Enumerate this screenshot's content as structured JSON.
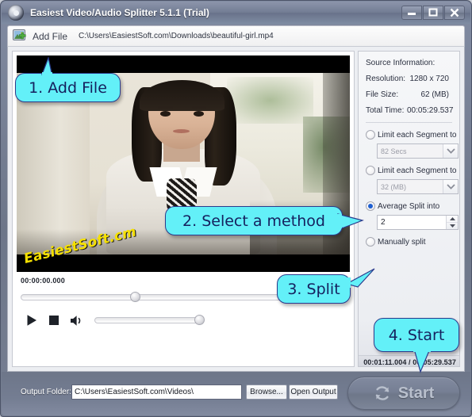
{
  "window": {
    "title": "Easiest Video/Audio Splitter 5.1.1 (Trial)",
    "logo_icon": "film-reel-icon",
    "buttons": {
      "minimize": "minimize-icon",
      "maximize": "maximize-icon",
      "close": "close-icon"
    }
  },
  "toolbar": {
    "add_file_icon": "add-image-plus-icon",
    "add_file_label": "Add File",
    "file_path": "C:\\Users\\EasiestSoft.com\\Downloads\\beautiful-girl.mp4"
  },
  "player": {
    "watermark": "EasiestSoft.cm",
    "current_time": "00:00:00.000",
    "duration_readout": "00:01:11.004 / 00:05:29.537",
    "seek_position_percent": 35,
    "volume_percent": 100,
    "controls": {
      "play": "play-icon",
      "stop": "stop-icon",
      "volume": "speaker-icon"
    }
  },
  "settings": {
    "source_title": "Source Information:",
    "info": [
      {
        "label": "Resolution:",
        "value": "1280 x 720"
      },
      {
        "label": "File Size:",
        "value": "62 (MB)"
      },
      {
        "label": "Total Time:",
        "value": "00:05:29.537"
      }
    ],
    "options": [
      {
        "label": "Limit each Segment to",
        "selected": false,
        "control": "combo",
        "value": "82 Secs"
      },
      {
        "label": "Limit each Segment to",
        "selected": false,
        "control": "combo",
        "value": "32 (MB)"
      },
      {
        "label": "Average Split into",
        "selected": true,
        "control": "spinner",
        "value": "2"
      },
      {
        "label": "Manually split",
        "selected": false,
        "control": "none",
        "value": ""
      }
    ],
    "split_button": "Split"
  },
  "bottom": {
    "output_label": "Output Folder:",
    "output_path": "C:\\Users\\EasiestSoft.com\\Videos\\",
    "browse_button": "Browse...",
    "open_output_button": "Open Output",
    "start_button": "Start",
    "start_icon": "refresh-circular-arrows-icon"
  },
  "callouts": {
    "one": "1. Add File",
    "two": "2. Select a method",
    "three": "3. Split",
    "four": "4. Start"
  },
  "colors": {
    "callout_fill": "#63f0f8",
    "callout_border": "#2a3a8c",
    "callout_text": "#15205e",
    "watermark": "#f5e000",
    "radio_selected": "#1e5fd0",
    "window_chrome": "#747d92"
  }
}
